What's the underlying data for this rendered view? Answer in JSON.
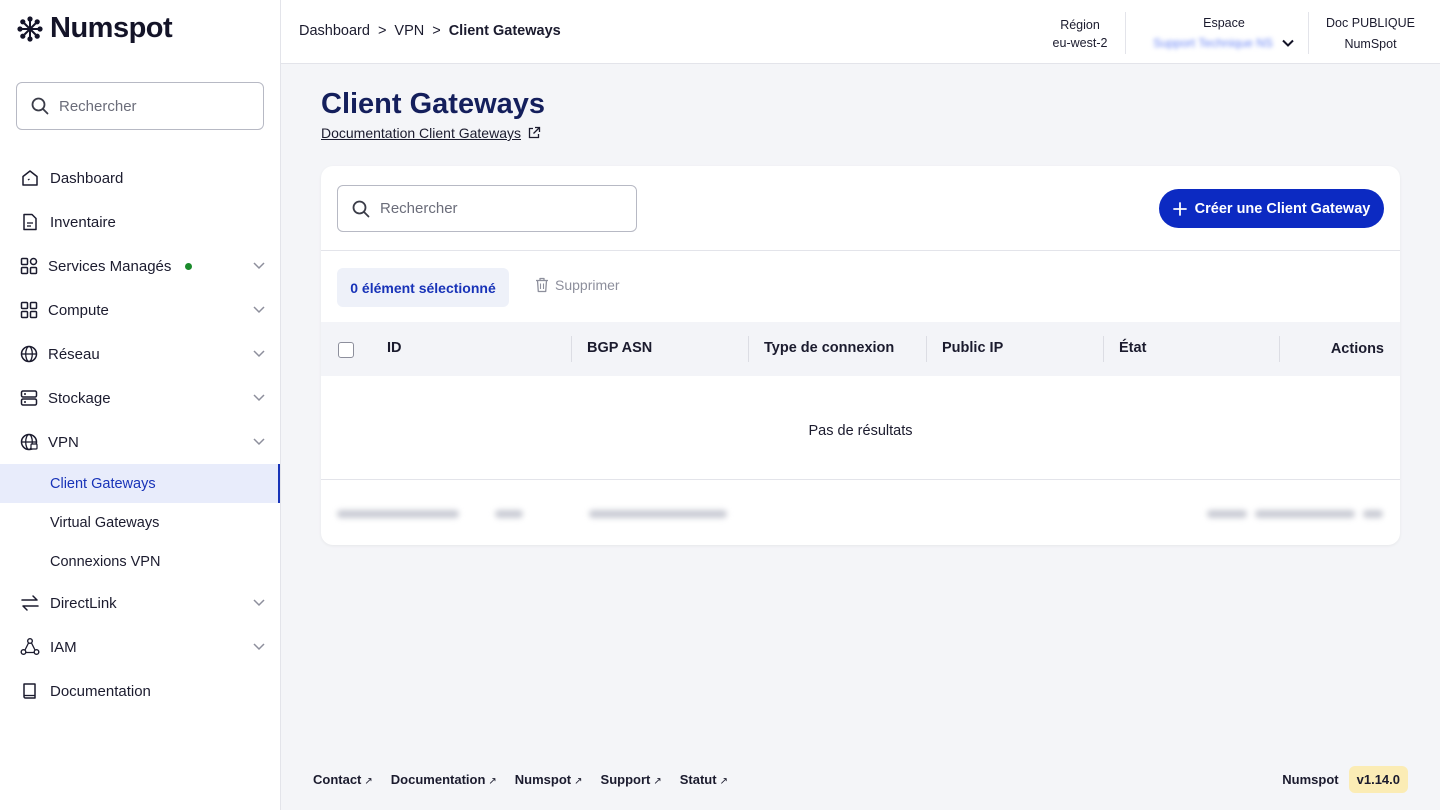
{
  "brand": {
    "name": "Numspot"
  },
  "sidebar": {
    "search_placeholder": "Rechercher",
    "items": [
      {
        "label": "Dashboard",
        "icon": "home-icon"
      },
      {
        "label": "Inventaire",
        "icon": "document-icon"
      },
      {
        "label": "Services Managés",
        "icon": "grid-services-icon",
        "status_dot": "#1a8a2b"
      },
      {
        "label": "Compute",
        "icon": "grid-icon"
      },
      {
        "label": "Réseau",
        "icon": "globe-icon"
      },
      {
        "label": "Stockage",
        "icon": "storage-icon"
      },
      {
        "label": "VPN",
        "icon": "vpn-globe-icon"
      },
      {
        "label": "DirectLink",
        "icon": "arrows-icon"
      },
      {
        "label": "IAM",
        "icon": "iam-icon"
      },
      {
        "label": "Documentation",
        "icon": "book-icon"
      }
    ],
    "vpn_subitems": [
      {
        "label": "Client Gateways",
        "active": true
      },
      {
        "label": "Virtual Gateways",
        "active": false
      },
      {
        "label": "Connexions VPN",
        "active": false
      }
    ]
  },
  "header": {
    "breadcrumb": [
      "Dashboard",
      "VPN",
      "Client Gateways"
    ],
    "breadcrumb_sep": ">",
    "region_label": "Région",
    "region_value": "eu-west-2",
    "space_label": "Espace",
    "space_value": "Support Technique NS",
    "doc_label": "Doc PUBLIQUE",
    "doc_value": "NumSpot"
  },
  "main": {
    "title": "Client Gateways",
    "doc_link": "Documentation Client Gateways",
    "search_placeholder": "Rechercher",
    "create_button": "Créer une Client Gateway",
    "selected_count": "0 élément sélectionné",
    "delete_button": "Supprimer",
    "columns": [
      "ID",
      "BGP ASN",
      "Type de connexion",
      "Public IP",
      "État",
      "Actions"
    ],
    "empty_message": "Pas de résultats"
  },
  "footer": {
    "links": [
      "Contact",
      "Documentation",
      "Numspot",
      "Support",
      "Statut"
    ],
    "brand": "Numspot",
    "version": "v1.14.0"
  },
  "colors": {
    "accent": "#0c2ac2",
    "title": "#141f5c",
    "active_bg": "#e8ecfb",
    "version_bg": "#fbecb5"
  }
}
